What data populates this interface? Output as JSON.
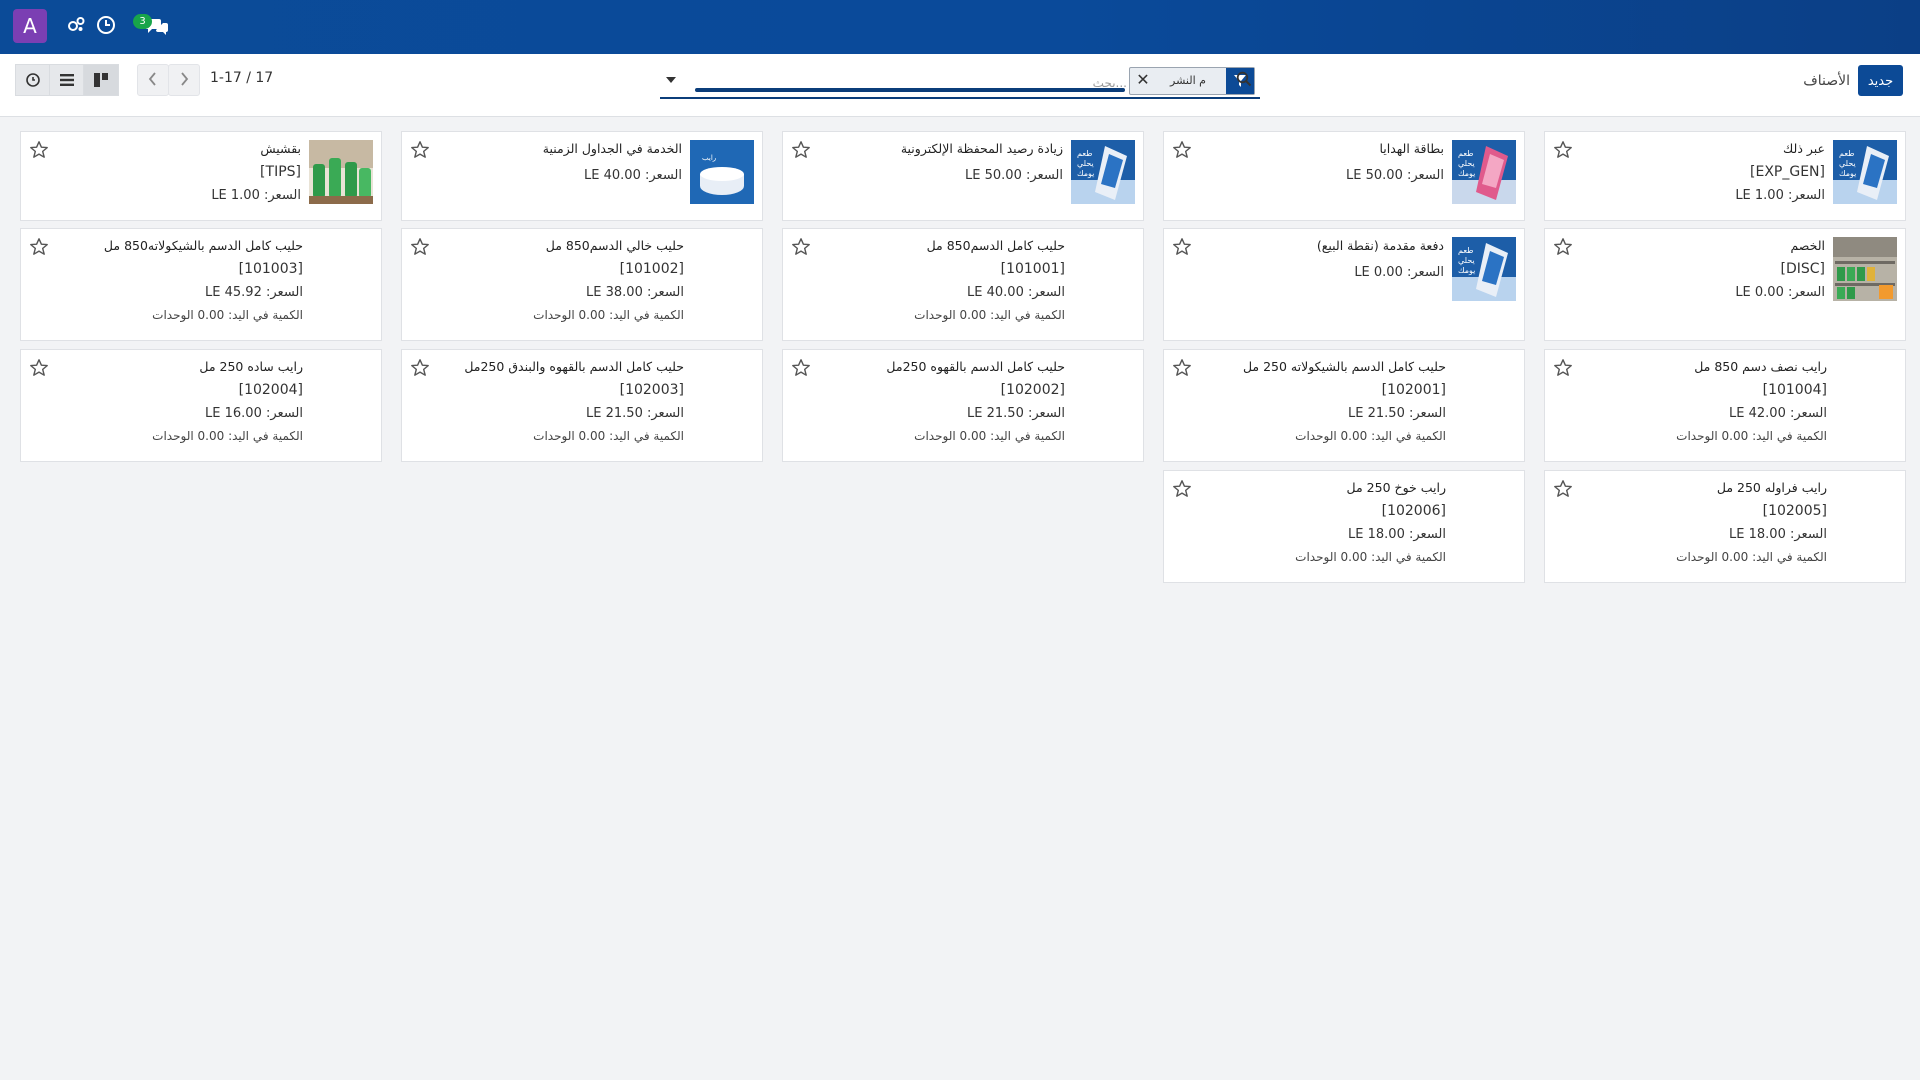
{
  "navbar": {
    "avatar_letter": "A",
    "notification_count": "3"
  },
  "control": {
    "new_button": "جديد",
    "breadcrumb": "الأصناف",
    "search_placeholder": "بحث...",
    "facet_label": "م النشر",
    "pager": "1-17 / 17"
  },
  "cards": [
    {
      "name": "عبر ذلك",
      "code": "[EXP_GEN]",
      "price": "السعر: LE 1.00",
      "qty": "",
      "image": "blue-milk-pack"
    },
    {
      "name": "بطاقة الهدايا",
      "code": "",
      "price": "السعر: LE 50.00",
      "qty": "",
      "image": "pink-milk-pack"
    },
    {
      "name": "زيادة رصيد المحفظة الإلكترونية",
      "code": "",
      "price": "السعر: LE 50.00",
      "qty": "",
      "image": "blue-milk-pack"
    },
    {
      "name": "الخدمة في الجداول الزمنية",
      "code": "",
      "price": "السعر: LE 40.00",
      "qty": "",
      "image": "blue-yogurt"
    },
    {
      "name": "بقشيش",
      "code": "[TIPS]",
      "price": "السعر: LE 1.00",
      "qty": "",
      "image": "green-bottles"
    },
    {
      "name": "الخصم",
      "code": "[DISC]",
      "price": "السعر: LE 0.00",
      "qty": "",
      "image": "store-shelf"
    },
    {
      "name": "دفعة مقدمة (نقطة البيع)",
      "code": "",
      "price": "السعر: LE 0.00",
      "qty": "",
      "image": "blue-milk-pack"
    },
    {
      "name": "حليب كامل الدسم850 مل",
      "code": "[101001]",
      "price": "السعر: LE 40.00",
      "qty": "الكمية في اليد: 0.00 الوحدات",
      "image": ""
    },
    {
      "name": "حليب خالي الدسم850 مل",
      "code": "[101002]",
      "price": "السعر: LE 38.00",
      "qty": "الكمية في اليد: 0.00 الوحدات",
      "image": ""
    },
    {
      "name": "حليب كامل الدسم بالشيكولاته850 مل",
      "code": "[101003]",
      "price": "السعر: LE 45.92",
      "qty": "الكمية في اليد: 0.00 الوحدات",
      "image": ""
    },
    {
      "name": "رايب نصف دسم 850 مل",
      "code": "[101004]",
      "price": "السعر: LE 42.00",
      "qty": "الكمية في اليد: 0.00 الوحدات",
      "image": ""
    },
    {
      "name": "حليب كامل الدسم بالشيكولاته 250 مل",
      "code": "[102001]",
      "price": "السعر: LE 21.50",
      "qty": "الكمية في اليد: 0.00 الوحدات",
      "image": ""
    },
    {
      "name": "حليب كامل الدسم بالقهوه 250مل",
      "code": "[102002]",
      "price": "السعر: LE 21.50",
      "qty": "الكمية في اليد: 0.00 الوحدات",
      "image": ""
    },
    {
      "name": "حليب كامل الدسم بالقهوه والبندق 250مل",
      "code": "[102003]",
      "price": "السعر: LE 21.50",
      "qty": "الكمية في اليد: 0.00 الوحدات",
      "image": ""
    },
    {
      "name": "رايب ساده 250 مل",
      "code": "[102004]",
      "price": "السعر: LE 16.00",
      "qty": "الكمية في اليد: 0.00 الوحدات",
      "image": ""
    },
    {
      "name": "رايب فراوله 250 مل",
      "code": "[102005]",
      "price": "السعر: LE 18.00",
      "qty": "الكمية في اليد: 0.00 الوحدات",
      "image": ""
    },
    {
      "name": "رايب خوخ 250 مل",
      "code": "[102006]",
      "price": "السعر: LE 18.00",
      "qty": "الكمية في اليد: 0.00 الوحدات",
      "image": ""
    }
  ]
}
